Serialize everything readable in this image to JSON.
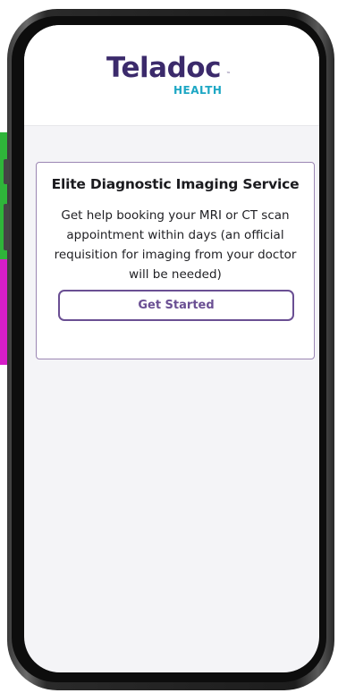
{
  "brand": {
    "name": "Teladoc",
    "trademark": "™",
    "sub": "HEALTH",
    "primary_color": "#3b2a6b",
    "accent_color": "#1da7c4"
  },
  "card": {
    "title": "Elite Diagnostic Imaging Service",
    "description": "Get help booking your MRI or CT scan appointment within days (an official requisition for imaging from your doctor will be needed)",
    "cta_label": "Get Started",
    "border_color": "#9b86b3",
    "cta_color": "#6a4f93"
  }
}
